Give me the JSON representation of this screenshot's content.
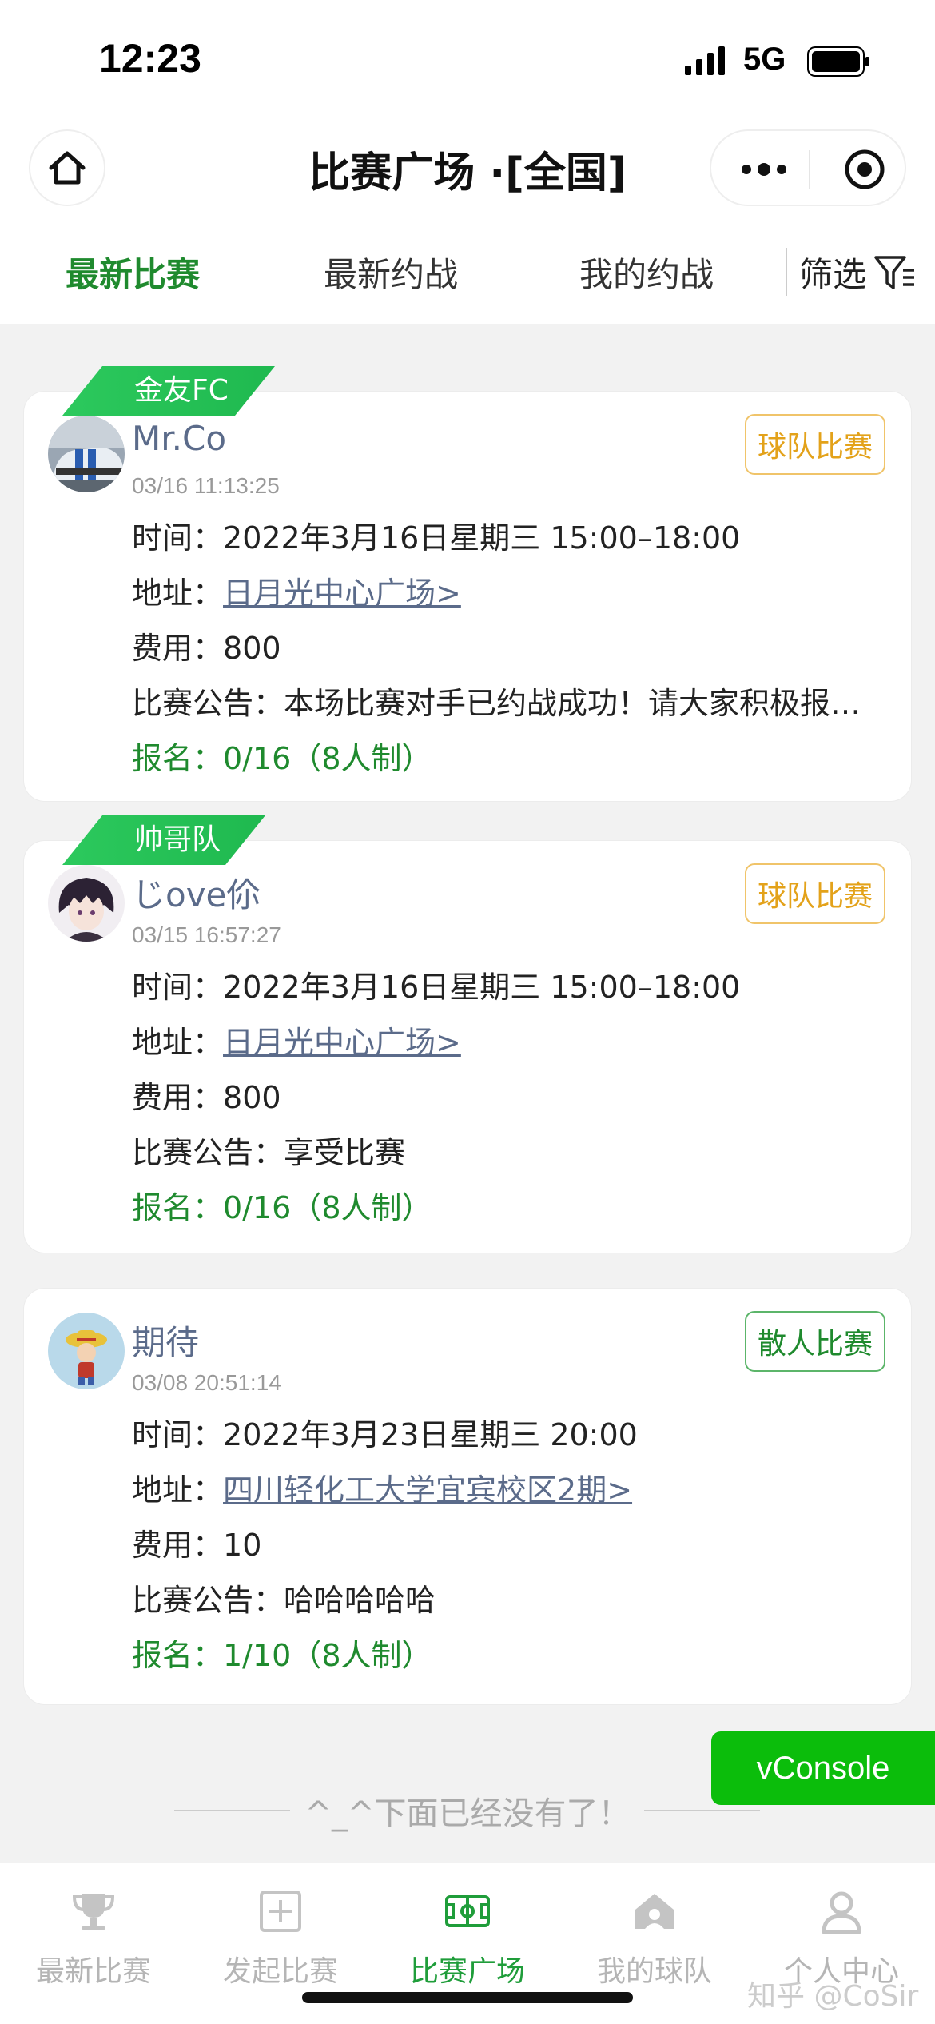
{
  "status_bar": {
    "time": "12:23",
    "network": "5G"
  },
  "nav": {
    "title": "比赛广场 ·[全国]",
    "home_icon": "home-icon",
    "more_icon": "more-icon",
    "target_icon": "target-icon"
  },
  "tabs": [
    {
      "label": "最新比赛",
      "active": true
    },
    {
      "label": "最新约战",
      "active": false
    },
    {
      "label": "我的约战",
      "active": false
    }
  ],
  "filter": {
    "label": "筛选",
    "icon": "filter-icon"
  },
  "matches": [
    {
      "team": "金友FC",
      "user": "Mr.Co",
      "posted": "03/16 11:13:25",
      "type": "球队比赛",
      "time_label": "时间：",
      "time_value": "2022年3月16日星期三 15:00–18:00",
      "addr_label": "地址：",
      "addr_value": "日月光中心广场>",
      "fee_label": "费用：",
      "fee_value": "800",
      "notice_label": "比赛公告：",
      "notice_value": "本场比赛对手已约战成功！请大家积极报…",
      "signup": "报名：0/16（8人制）"
    },
    {
      "team": "帅哥队",
      "user": "じove伱",
      "posted": "03/15 16:57:27",
      "type": "球队比赛",
      "time_label": "时间：",
      "time_value": "2022年3月16日星期三 15:00–18:00",
      "addr_label": "地址：",
      "addr_value": "日月光中心广场>",
      "fee_label": "费用：",
      "fee_value": "800",
      "notice_label": "比赛公告：",
      "notice_value": "享受比赛",
      "signup": "报名：0/16（8人制）"
    },
    {
      "user": "期待",
      "posted": "03/08 20:51:14",
      "type": "散人比赛",
      "time_label": "时间：",
      "time_value": "2022年3月23日星期三 20:00",
      "addr_label": "地址：",
      "addr_value": "四川轻化工大学宜宾校区2期>",
      "fee_label": "费用：",
      "fee_value": "10",
      "notice_label": "比赛公告：",
      "notice_value": "哈哈哈哈哈",
      "signup": "报名：1/10（8人制）"
    }
  ],
  "end_note": "^_^下面已经没有了！",
  "vconsole": "vConsole",
  "tabbar": [
    {
      "label": "最新比赛",
      "icon": "trophy-icon",
      "active": false
    },
    {
      "label": "发起比赛",
      "icon": "add-square-icon",
      "active": false
    },
    {
      "label": "比赛广场",
      "icon": "soccer-field-icon",
      "active": true
    },
    {
      "label": "我的球队",
      "icon": "team-house-icon",
      "active": false
    },
    {
      "label": "个人中心",
      "icon": "user-icon",
      "active": false
    }
  ],
  "watermark": "知乎 @CoSir",
  "colors": {
    "accent": "#1f8a2e",
    "ribbon": "#2cc95d",
    "team_badge": "#e3a21a",
    "link": "#5b6b8a"
  }
}
